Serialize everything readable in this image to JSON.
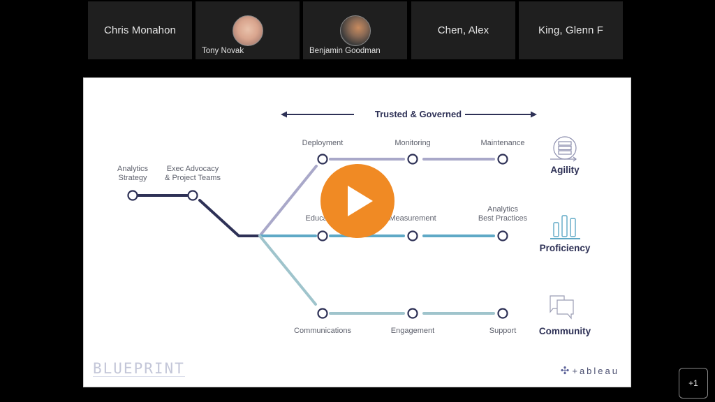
{
  "participants": [
    {
      "name": "Chris Monahon",
      "has_video_avatar": false
    },
    {
      "name": "Tony Novak",
      "has_video_avatar": true
    },
    {
      "name": "Benjamin Goodman",
      "has_video_avatar": true
    },
    {
      "name": "Chen, Alex",
      "has_video_avatar": false
    },
    {
      "name": "King, Glenn F",
      "has_video_avatar": false
    }
  ],
  "overflow_count_label": "+1",
  "shared_slide": {
    "banner": "Trusted & Governed",
    "start_nodes": [
      {
        "label_line1": "Analytics",
        "label_line2": "Strategy"
      },
      {
        "label_line1": "Exec Advocacy",
        "label_line2": "& Project Teams"
      }
    ],
    "tracks": [
      {
        "category": "Agility",
        "category_icon": "server-cycle-icon",
        "nodes": [
          "Deployment",
          "Monitoring",
          "Maintenance"
        ]
      },
      {
        "category": "Proficiency",
        "category_icon": "bar-chart-icon",
        "nodes": [
          "Education",
          "Measurement",
          "Analytics Best Practices"
        ],
        "node_label_lines": [
          [
            "Education"
          ],
          [
            "Measurement"
          ],
          [
            "Analytics",
            "Best Practices"
          ]
        ]
      },
      {
        "category": "Community",
        "category_icon": "chat-bubbles-icon",
        "nodes": [
          "Communications",
          "Engagement",
          "Support"
        ]
      }
    ],
    "footer_left": "BLUEPRINT",
    "footer_right_brand": "+ableau",
    "footer_right_mark": "✣"
  },
  "play_button": {
    "icon": "play-icon",
    "color": "#f08a24"
  },
  "colors": {
    "navy": "#2e3156",
    "agility_line": "#a9a8c9",
    "proficiency_line": "#5fa9c6",
    "community_line": "#9fc4cc"
  }
}
